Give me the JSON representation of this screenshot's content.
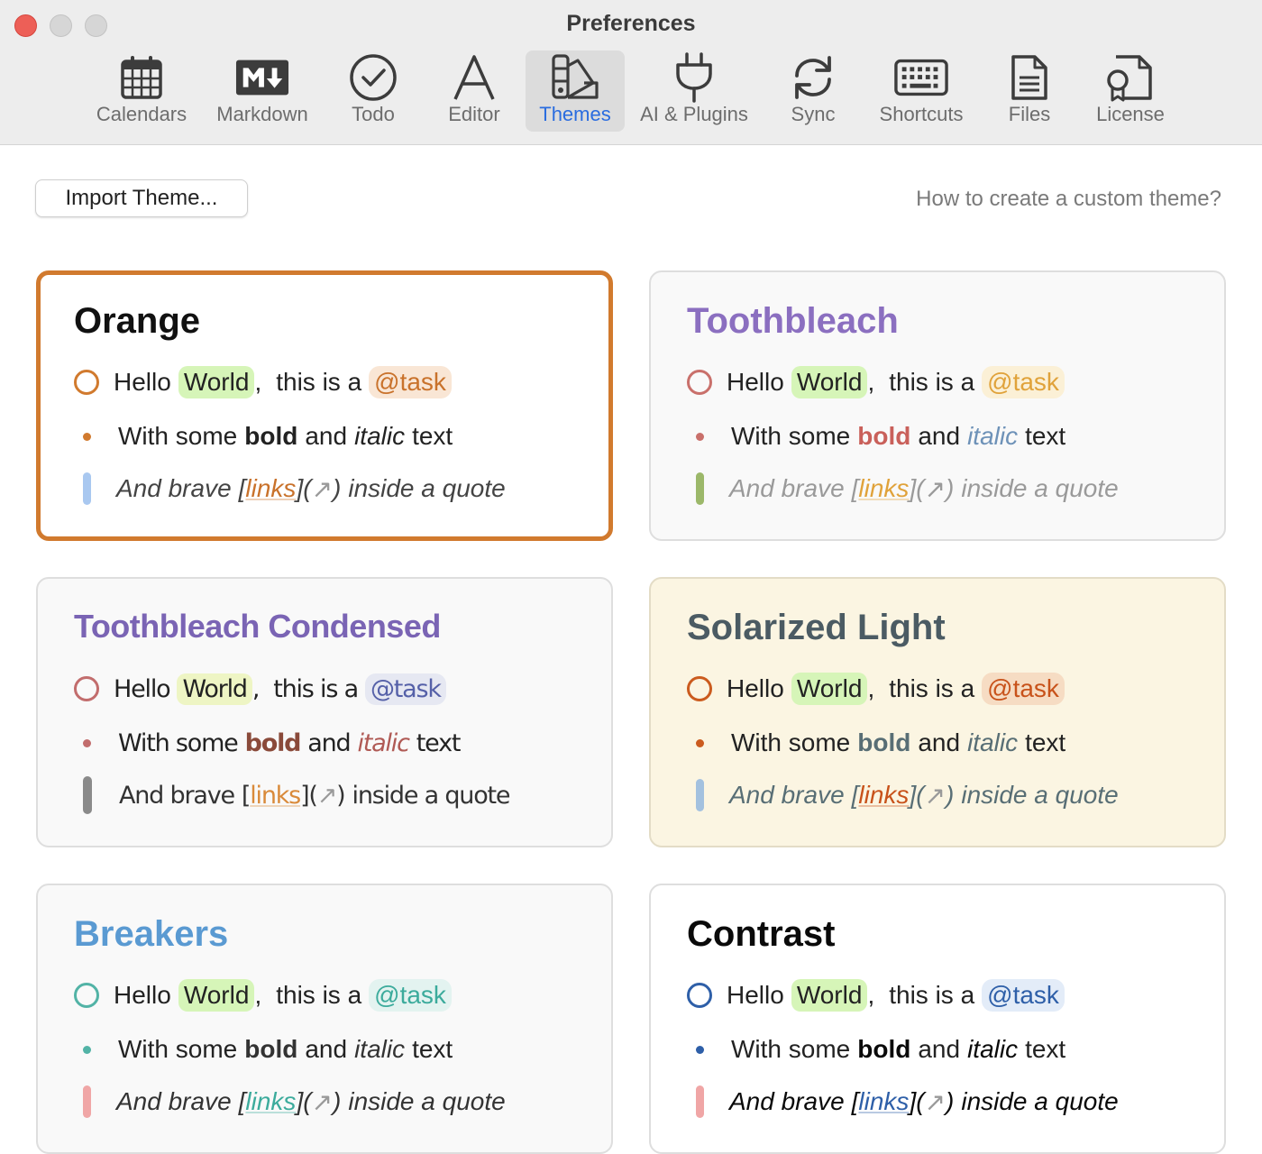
{
  "window": {
    "title": "Preferences"
  },
  "toolbar": {
    "items": [
      {
        "label": "Calendars",
        "icon": "calendar-icon"
      },
      {
        "label": "Markdown",
        "icon": "markdown-icon"
      },
      {
        "label": "Todo",
        "icon": "checkmark-circle-icon"
      },
      {
        "label": "Editor",
        "icon": "font-a-icon"
      },
      {
        "label": "Themes",
        "icon": "swatches-icon",
        "active": true
      },
      {
        "label": "AI & Plugins",
        "icon": "plug-icon"
      },
      {
        "label": "Sync",
        "icon": "sync-icon"
      },
      {
        "label": "Shortcuts",
        "icon": "keyboard-icon"
      },
      {
        "label": "Files",
        "icon": "file-icon"
      },
      {
        "label": "License",
        "icon": "license-icon"
      }
    ],
    "active_color": "#2a6cdf"
  },
  "actions": {
    "import_label": "Import Theme...",
    "help_link": "How to create a custom theme?"
  },
  "preview_text": {
    "hello": "Hello",
    "world": "World",
    "comma": ",",
    "this_is_a": "this is a",
    "task": "@task",
    "with_some": "With some",
    "bold": "bold",
    "and": "and",
    "italic": "italic",
    "text": "text",
    "and_brave": "And brave",
    "open_bracket": "[",
    "links": "links",
    "close_bracket": "](",
    "arrow": "↗",
    "close_paren": ")",
    "inside_a_quote": "inside a quote"
  },
  "themes": [
    {
      "name": "Orange",
      "selected": true,
      "title_color": "#111111",
      "accent": "#d17a2e",
      "bg": "#ffffff",
      "quote_bar": "#a9c8f0",
      "highlight": "#d6f5b8",
      "task_bg": "#f9e6d5",
      "task_color": "#c9722b",
      "bold_color": "#222222",
      "italic_color": "#222222",
      "link_color": "#c9722b",
      "quote_color": "#444444"
    },
    {
      "name": "Toothbleach",
      "selected": false,
      "title_color": "#8b6fc0",
      "accent": "#c9706b",
      "bg": "#f9f9f9",
      "quote_bar": "#9cb86a",
      "highlight": "#d6f5b8",
      "task_bg": "#fbf0d6",
      "task_color": "#e0a23a",
      "bold_color": "#c9605a",
      "italic_color": "#6e92b8",
      "link_color": "#e0a23a",
      "quote_color": "#9a9a9a"
    },
    {
      "name": "Toothbleach Condensed",
      "selected": false,
      "title_color": "#7a64b4",
      "accent": "#c26d6d",
      "bg": "#f9f9f9",
      "quote_bar": "#8a8a8a",
      "highlight": "#eef5c4",
      "task_bg": "#e6e8f2",
      "task_color": "#5560a8",
      "bold_color": "#8a4a3a",
      "italic_color": "#b05a55",
      "link_color": "#d98a3a",
      "quote_color": "#333333"
    },
    {
      "name": "Solarized Light",
      "selected": false,
      "title_color": "#4b5b63",
      "accent": "#cb5b1e",
      "bg": "#fbf5e2",
      "quote_bar": "#a3c1df",
      "highlight": "#d6f5b8",
      "task_bg": "#f6dcc3",
      "task_color": "#c8521a",
      "bold_color": "#586e75",
      "italic_color": "#586e75",
      "link_color": "#c8521a",
      "quote_color": "#586e75"
    },
    {
      "name": "Breakers",
      "selected": false,
      "title_color": "#5a9ad2",
      "accent": "#52b3a6",
      "bg": "#f9f9f9",
      "quote_bar": "#f0a6a6",
      "highlight": "#d6f5b8",
      "task_bg": "#e3f3f0",
      "task_color": "#3cab9c",
      "bold_color": "#333333",
      "italic_color": "#333333",
      "link_color": "#3cab9c",
      "quote_color": "#333333"
    },
    {
      "name": "Contrast",
      "selected": false,
      "title_color": "#0a0a0a",
      "accent": "#2e5fa8",
      "bg": "#ffffff",
      "quote_bar": "#f0a6a6",
      "highlight": "#d6f5b8",
      "task_bg": "#e3ecf8",
      "task_color": "#2e5fa8",
      "bold_color": "#0a0a0a",
      "italic_color": "#0a0a0a",
      "link_color": "#2e5fa8",
      "quote_color": "#0a0a0a"
    }
  ]
}
